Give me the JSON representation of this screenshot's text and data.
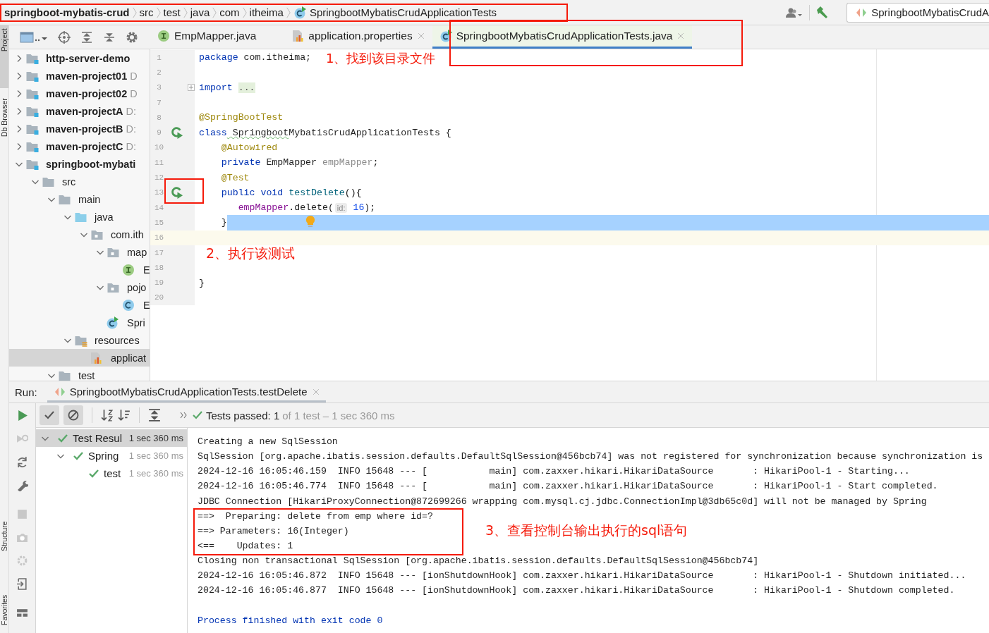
{
  "breadcrumb": [
    {
      "label": "springboot-mybatis-crud",
      "kind": "project"
    },
    {
      "label": "src",
      "kind": "folder"
    },
    {
      "label": "test",
      "kind": "folder"
    },
    {
      "label": "java",
      "kind": "folder"
    },
    {
      "label": "com",
      "kind": "folder"
    },
    {
      "label": "itheima",
      "kind": "folder"
    },
    {
      "label": "SpringbootMybatisCrudApplicationTests",
      "kind": "test-class"
    }
  ],
  "run_config": {
    "label": "SpringbootMybatisCrudA"
  },
  "side_tabs": [
    {
      "label": "Project",
      "selected": true
    },
    {
      "label": "Db Browser",
      "selected": false
    },
    {
      "label": "Structure",
      "selected": false
    },
    {
      "label": "Favorites",
      "selected": false
    }
  ],
  "editor_tabs": [
    {
      "label": "EmpMapper.java",
      "kind": "interface",
      "selected": false,
      "closable": false
    },
    {
      "label": "application.properties",
      "kind": "properties",
      "selected": false,
      "closable": true
    },
    {
      "label": "SpringbootMybatisCrudApplicationTests.java",
      "kind": "test-class",
      "selected": true,
      "closable": true
    }
  ],
  "project_tree": [
    {
      "label": "http-server-demo",
      "kind": "module",
      "expanded": false,
      "selected": false
    },
    {
      "label": "maven-project01",
      "path": "D",
      "kind": "module",
      "expanded": false,
      "selected": false
    },
    {
      "label": "maven-project02",
      "path": "D",
      "kind": "module",
      "expanded": false,
      "selected": false
    },
    {
      "label": "maven-projectA",
      "path": "D:",
      "kind": "module",
      "expanded": false,
      "selected": false
    },
    {
      "label": "maven-projectB",
      "path": "D:",
      "kind": "module",
      "expanded": false,
      "selected": false
    },
    {
      "label": "maven-projectC",
      "path": "D:",
      "kind": "module",
      "expanded": false,
      "selected": false
    },
    {
      "label": "springboot-mybati",
      "kind": "module",
      "expanded": true,
      "selected": false,
      "children": [
        {
          "label": "src",
          "kind": "folder",
          "expanded": true,
          "selected": false,
          "children": [
            {
              "label": "main",
              "kind": "folder",
              "expanded": true,
              "selected": false,
              "children": [
                {
                  "label": "java",
                  "kind": "source-root",
                  "expanded": true,
                  "selected": false,
                  "children": [
                    {
                      "label": "com.ith",
                      "kind": "package",
                      "expanded": true,
                      "selected": false,
                      "children": [
                        {
                          "label": "map",
                          "kind": "package",
                          "expanded": true,
                          "selected": false,
                          "children": [
                            {
                              "label": "E",
                              "kind": "interface",
                              "selected": false
                            }
                          ]
                        },
                        {
                          "label": "pojo",
                          "kind": "package",
                          "expanded": true,
                          "selected": false,
                          "children": [
                            {
                              "label": "E",
                              "kind": "class",
                              "selected": false
                            }
                          ]
                        },
                        {
                          "label": "Spri",
                          "kind": "spring-class",
                          "selected": false
                        }
                      ]
                    }
                  ]
                },
                {
                  "label": "resources",
                  "kind": "resources-root",
                  "expanded": true,
                  "selected": false,
                  "children": [
                    {
                      "label": "applicat",
                      "kind": "properties",
                      "selected": true
                    }
                  ]
                }
              ]
            },
            {
              "label": "test",
              "kind": "folder",
              "expanded": true,
              "selected": false
            }
          ]
        }
      ]
    }
  ],
  "code_lines": [
    {
      "number": "1",
      "tokens": [
        {
          "text": "package",
          "kind": "keyword"
        },
        {
          "text": " com.itheima;",
          "kind": "plain"
        }
      ],
      "run_icon": false,
      "selection": false,
      "current": false,
      "bulb": false
    },
    {
      "number": "2",
      "run_icon": false,
      "selection": false,
      "current": false,
      "bulb": false
    },
    {
      "number": "3",
      "tokens": [
        {
          "text": "import",
          "kind": "keyword"
        },
        {
          "text": "...",
          "kind": "folded"
        }
      ],
      "run_icon": false,
      "selection": false,
      "current": false,
      "bulb": false
    },
    {
      "number": "7",
      "run_icon": false,
      "selection": false,
      "current": false,
      "bulb": false
    },
    {
      "number": "8",
      "tokens": [
        {
          "text": "@SpringBootTest",
          "kind": "annotation"
        }
      ],
      "run_icon": false,
      "selection": false,
      "current": false,
      "bulb": false
    },
    {
      "number": "9",
      "tokens": [
        {
          "text": "class",
          "kind": "keyword"
        },
        {
          "text": " Springboot",
          "kind": "typo"
        },
        {
          "text": "MybatisCrudApplicationTests {",
          "kind": "plain"
        }
      ],
      "run_icon": true,
      "selection": false,
      "current": false,
      "bulb": false
    },
    {
      "number": "10",
      "tokens": [
        {
          "text": "    @Autowired",
          "kind": "annotation"
        }
      ],
      "run_icon": false,
      "selection": false,
      "current": false,
      "bulb": false
    },
    {
      "number": "11",
      "tokens": [
        {
          "text": "    private",
          "kind": "keyword"
        },
        {
          "text": " EmpMapper ",
          "kind": "plain"
        },
        {
          "text": "empMapper",
          "kind": "unused"
        },
        {
          "text": ";",
          "kind": "plain"
        }
      ],
      "run_icon": false,
      "selection": false,
      "current": false,
      "bulb": false
    },
    {
      "number": "12",
      "tokens": [
        {
          "text": "    @Test",
          "kind": "annotation"
        }
      ],
      "run_icon": false,
      "selection": false,
      "current": false,
      "bulb": false
    },
    {
      "number": "13",
      "tokens": [
        {
          "text": "    public",
          "kind": "keyword"
        },
        {
          "text": " void",
          "kind": "keyword"
        },
        {
          "text": " testDelete",
          "kind": "method"
        },
        {
          "text": "(){",
          "kind": "plain"
        }
      ],
      "run_icon": true,
      "selection": false,
      "current": false,
      "bulb": false
    },
    {
      "number": "14",
      "tokens": [
        {
          "text": "       empMapper",
          "kind": "field"
        },
        {
          "text": ".delete(",
          "kind": "plain"
        },
        {
          "text": "id:",
          "kind": "hint"
        },
        {
          "text": " 16",
          "kind": "number"
        },
        {
          "text": ");",
          "kind": "plain"
        }
      ],
      "run_icon": false,
      "selection": false,
      "current": false,
      "bulb": false
    },
    {
      "number": "15",
      "tokens": [
        {
          "text": "    }",
          "kind": "plain"
        }
      ],
      "run_icon": false,
      "selection": true,
      "current": false,
      "bulb": true
    },
    {
      "number": "16",
      "run_icon": false,
      "selection": false,
      "current": true,
      "bulb": false
    },
    {
      "number": "17",
      "run_icon": false,
      "selection": false,
      "current": false,
      "bulb": false
    },
    {
      "number": "18",
      "run_icon": false,
      "selection": false,
      "current": false,
      "bulb": false
    },
    {
      "number": "19",
      "tokens": [
        {
          "text": "}",
          "kind": "plain"
        }
      ],
      "run_icon": false,
      "selection": false,
      "current": false,
      "bulb": false
    },
    {
      "number": "20",
      "run_icon": false,
      "selection": false,
      "current": false,
      "bulb": false
    }
  ],
  "run": {
    "title": "Run:",
    "tab": {
      "label": "SpringbootMybatisCrudApplicationTests.testDelete",
      "closable": true
    },
    "toggles": [
      {
        "kind": "show-passed",
        "selected": true
      },
      {
        "kind": "show-ignored",
        "selected": true
      }
    ],
    "status": {
      "passed": "Tests passed: 1",
      "detail": "of 1 test – 1 sec 360 ms"
    },
    "results": [
      {
        "label": "Test Resul",
        "time": "1 sec 360 ms",
        "passed": true,
        "expanded": true,
        "selected": true,
        "children": [
          {
            "label": "Spring",
            "time": "1 sec 360 ms",
            "passed": true,
            "expanded": true,
            "selected": false,
            "children": [
              {
                "label": "test",
                "time": "1 sec 360 ms",
                "passed": true,
                "selected": false
              }
            ]
          }
        ]
      }
    ],
    "console": [
      {
        "text": "Creating a new SqlSession",
        "kind": "log"
      },
      {
        "text": "SqlSession [org.apache.ibatis.session.defaults.DefaultSqlSession@456bcb74] was not registered for synchronization because synchronization is",
        "kind": "log"
      },
      {
        "text": "2024-12-16 16:05:46.159  INFO 15648 --- [           main] com.zaxxer.hikari.HikariDataSource       : HikariPool-1 - Starting...",
        "kind": "log"
      },
      {
        "text": "2024-12-16 16:05:46.774  INFO 15648 --- [           main] com.zaxxer.hikari.HikariDataSource       : HikariPool-1 - Start completed.",
        "kind": "log"
      },
      {
        "text": "JDBC Connection [HikariProxyConnection@872699266 wrapping com.mysql.cj.jdbc.ConnectionImpl@3db65c0d] will not be managed by Spring",
        "kind": "log"
      },
      {
        "text": "==>  Preparing: delete from emp where id=?",
        "kind": "log"
      },
      {
        "text": "==> Parameters: 16(Integer)",
        "kind": "log"
      },
      {
        "text": "<==    Updates: 1",
        "kind": "log"
      },
      {
        "text": "Closing non transactional SqlSession [org.apache.ibatis.session.defaults.DefaultSqlSession@456bcb74]",
        "kind": "log"
      },
      {
        "text": "2024-12-16 16:05:46.872  INFO 15648 --- [ionShutdownHook] com.zaxxer.hikari.HikariDataSource       : HikariPool-1 - Shutdown initiated...",
        "kind": "log"
      },
      {
        "text": "2024-12-16 16:05:46.877  INFO 15648 --- [ionShutdownHook] com.zaxxer.hikari.HikariDataSource       : HikariPool-1 - Shutdown completed.",
        "kind": "log"
      },
      {
        "text": "Process finished with exit code 0",
        "kind": "exit"
      }
    ]
  },
  "annotations": [
    {
      "text": "1、找到该目录文件"
    },
    {
      "text": "2、执行该测试"
    },
    {
      "text": "3、查看控制台输出执行的sql语句"
    }
  ]
}
